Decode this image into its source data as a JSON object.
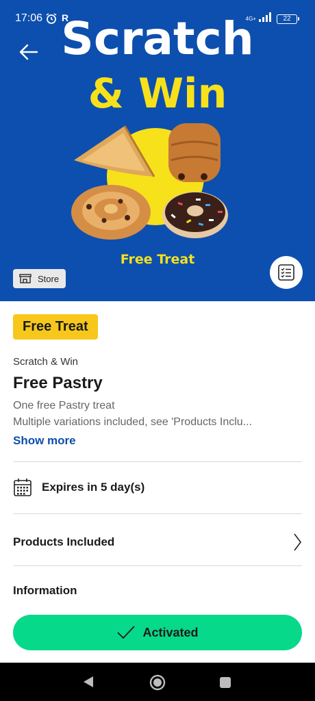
{
  "status_bar": {
    "time": "17:06",
    "carrier_mark": "R",
    "network": "4G+",
    "battery": "22"
  },
  "hero": {
    "title_line1": "Scratch",
    "title_line2": "& Win",
    "subtitle": "Free Treat",
    "store_label": "Store",
    "colors": {
      "background": "#0d4fae",
      "accent": "#f7e11b"
    }
  },
  "offer": {
    "badge": "Free Treat",
    "category": "Scratch & Win",
    "title": "Free Pastry",
    "description_line1": "One free Pastry treat",
    "description_line2": "Multiple variations included, see 'Products Inclu...",
    "show_more": "Show more"
  },
  "details": {
    "expiry": "Expires in 5 day(s)",
    "products_included": "Products Included",
    "information": "Information"
  },
  "action": {
    "label": "Activated",
    "color": "#07d98a"
  },
  "icons": [
    "back-arrow-icon",
    "alarm-clock-icon",
    "signal-icon",
    "battery-icon",
    "store-icon",
    "checklist-icon",
    "calendar-icon",
    "chevron-right-icon",
    "checkmark-icon",
    "nav-back-icon",
    "nav-home-icon",
    "nav-recents-icon"
  ]
}
